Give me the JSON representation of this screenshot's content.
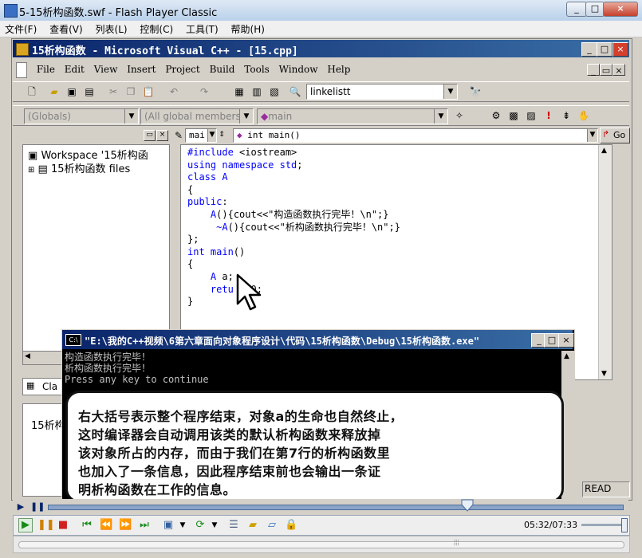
{
  "flash_player": {
    "title": "5-15析构函数.swf - Flash Player Classic",
    "menu": [
      "文件(F)",
      "查看(V)",
      "列表(L)",
      "控制(C)",
      "工具(T)",
      "帮助(H)"
    ],
    "min": "_",
    "max": "□",
    "close": "×"
  },
  "vc": {
    "title": "15析构函数 - Microsoft Visual C++ - [15.cpp]",
    "menu": [
      "File",
      "Edit",
      "View",
      "Insert",
      "Project",
      "Build",
      "Tools",
      "Window",
      "Help"
    ],
    "find_value": "linkelistt",
    "globals_combo": "(Globals)",
    "members_combo": "(All global members",
    "function_combo": "main",
    "editor_scope": "mai",
    "editor_function": "int main()",
    "go_label": "Go",
    "read_status": "READ",
    "workspace_item1": "Workspace '15析构函",
    "workspace_item2": "15析构函数 files",
    "workspace_tab": "Cla",
    "output_text": "15析构"
  },
  "code_lines": [
    {
      "pre": "",
      "kw": "#include",
      "rest": " <iostream>"
    },
    {
      "pre": "",
      "kw": "using namespace std",
      "rest": ";"
    },
    {
      "pre": "",
      "kw": "class A",
      "rest": ""
    },
    {
      "pre": "",
      "kw": "",
      "rest": "{"
    },
    {
      "pre": "",
      "kw": "public",
      "rest": ":"
    },
    {
      "pre": "    ",
      "kw": "A",
      "rest": "(){cout<<\"构造函数执行完毕！\\n\";}"
    },
    {
      "pre": "     ",
      "kw": "~A",
      "rest": "(){cout<<\"析构函数执行完毕！\\n\";}"
    },
    {
      "pre": "",
      "kw": "",
      "rest": "};"
    },
    {
      "pre": "",
      "kw": "int main",
      "rest": "()"
    },
    {
      "pre": "",
      "kw": "",
      "rest": "{"
    },
    {
      "pre": "    ",
      "kw": "A",
      "rest": " a;"
    },
    {
      "pre": "    ",
      "kw": "retu",
      "rest": "   0;"
    },
    {
      "pre": "",
      "kw": "",
      "rest": "}"
    }
  ],
  "console": {
    "title": "\"E:\\我的C++视频\\6第六章面向对象程序设计\\代码\\15析构函数\\Debug\\15析构函数.exe\"",
    "lines": [
      "构造函数执行完毕！",
      "析构函数执行完毕！",
      "Press any key to continue"
    ]
  },
  "subtitle": [
    "右大括号表示整个程序结束，对象a的生命也自然终止，",
    "这时编译器会自动调用该类的默认析构函数来释放掉",
    "该对象所占的内存，而由于我们在第7行的析构函数里",
    "也加入了一条信息，因此程序结束前也会输出一条证",
    "明析构函数在工作的信息。"
  ],
  "player": {
    "time": "05:32/07:33",
    "progress": 0.73,
    "play_icon": "play-icon",
    "pause_icon": "pause-icon",
    "stop_icon": "stop-icon"
  }
}
